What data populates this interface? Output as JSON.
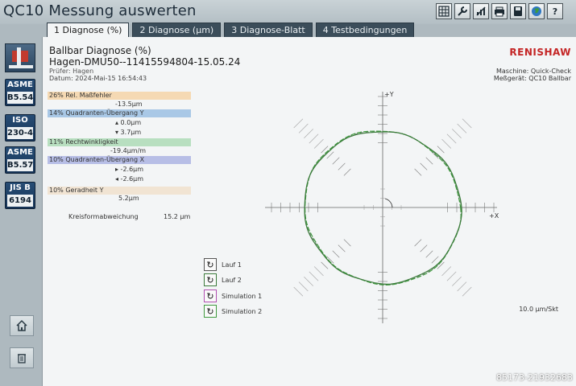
{
  "app": {
    "title": "QC10 Messung auswerten"
  },
  "toolbar": {
    "buttons": [
      "table-icon",
      "wrench-icon",
      "chart-icon",
      "printer-icon",
      "save-icon",
      "globe-icon",
      "help-icon"
    ]
  },
  "tabs": [
    {
      "label": "1 Diagnose (%)",
      "active": true
    },
    {
      "label": "2 Diagnose (µm)",
      "active": false
    },
    {
      "label": "3 Diagnose-Blatt",
      "active": false
    },
    {
      "label": "4 Testbedingungen",
      "active": false
    }
  ],
  "sidebar": {
    "standards": [
      {
        "top": "ASME",
        "bottom": "B5.54"
      },
      {
        "top": "ISO",
        "bottom": "230-4"
      },
      {
        "top": "ASME",
        "bottom": "B5.57"
      },
      {
        "top": "JIS B",
        "bottom": "6194"
      }
    ]
  },
  "report": {
    "title": "Ballbar Diagnose (%)",
    "file": "Hagen-DMU50--11415594804-15.05.24",
    "pruefer": "Prüfer: Hagen",
    "datum": "Datum: 2024-Mai-15 16:54:43",
    "brand": "RENISHAW",
    "machine": "Maschine: Quick-Check",
    "device": "Meßgerät: QC10 Ballbar"
  },
  "diagnostics": [
    {
      "label": "26%  Rel. Maßfehler",
      "color": "#f5d9b3",
      "values": [
        "-13.5µm"
      ]
    },
    {
      "label": "14%  Quadranten-Übergang Y",
      "color": "#a9c8e6",
      "values": [
        "▴ 0.0µm",
        "▾ 3.7µm"
      ]
    },
    {
      "label": "11%  Rechtwinkligkeit",
      "color": "#b8dfc0",
      "values": [
        "-19.4µm/m"
      ]
    },
    {
      "label": "10%  Quadranten-Übergang X",
      "color": "#b7bee6",
      "values": [
        "▸ -2.6µm",
        "◂ -2.6µm"
      ]
    },
    {
      "label": "10%  Geradheit Y",
      "color": "#f1e4d3",
      "values": [
        "5.2µm"
      ]
    }
  ],
  "circularity": {
    "label": "Kreisformabweichung",
    "value": "15.2 µm"
  },
  "legend": [
    {
      "label": "Lauf 1",
      "color": "#3a3a3a"
    },
    {
      "label": "Lauf 2",
      "color": "#3a7a3a"
    },
    {
      "label": "Simulation 1",
      "color": "#b04fb0"
    },
    {
      "label": "Simulation 2",
      "color": "#3f9a3f"
    }
  ],
  "plot": {
    "x_label": "+X",
    "y_label": "+Y",
    "scale": "10.0 µm/Skt"
  },
  "watermark": "85173-21932683"
}
